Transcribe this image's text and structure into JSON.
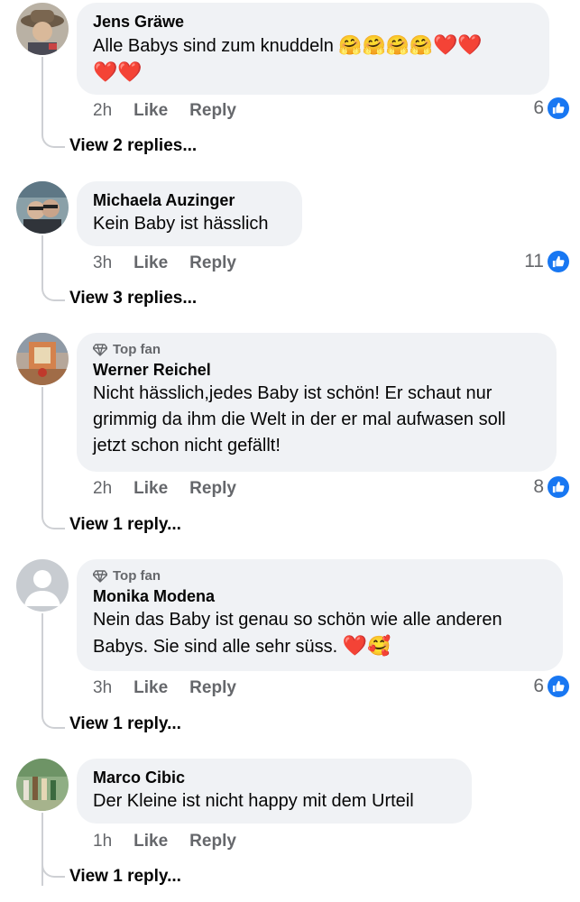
{
  "comments": [
    {
      "name": "Jens Gräwe",
      "top_fan": false,
      "text": "Alle Babys sind zum knuddeln",
      "emoji": [
        "🤗",
        "🤗",
        "🤗",
        "🤗",
        "❤️",
        "❤️",
        "❤️",
        "❤️"
      ],
      "time": "2h",
      "like_label": "Like",
      "reply_label": "Reply",
      "reaction_count": "6",
      "view_replies": "View 2 replies..."
    },
    {
      "name": "Michaela Auzinger",
      "top_fan": false,
      "text": "Kein Baby ist hässlich",
      "time": "3h",
      "like_label": "Like",
      "reply_label": "Reply",
      "reaction_count": "11",
      "view_replies": "View 3 replies..."
    },
    {
      "name": "Werner Reichel",
      "top_fan": true,
      "top_fan_label": "Top fan",
      "text": "Nicht hässlich,jedes Baby ist schön! Er schaut nur grimmig da ihm die Welt in der er mal aufwasen soll jetzt schon nicht gefällt!",
      "time": "2h",
      "like_label": "Like",
      "reply_label": "Reply",
      "reaction_count": "8",
      "view_replies": "View 1 reply..."
    },
    {
      "name": "Monika Modena",
      "top_fan": true,
      "top_fan_label": "Top fan",
      "text": "Nein das Baby ist genau so schön wie alle anderen Babys. Sie sind alle sehr süss.",
      "emoji": [
        "❤️",
        "🥰"
      ],
      "time": "3h",
      "like_label": "Like",
      "reply_label": "Reply",
      "reaction_count": "6",
      "view_replies": "View 1 reply..."
    },
    {
      "name": "Marco Cibic",
      "top_fan": false,
      "text": "Der Kleine ist nicht happy mit dem Urteil",
      "time": "1h",
      "like_label": "Like",
      "reply_label": "Reply",
      "view_replies": "View 1 reply..."
    }
  ],
  "colors": {
    "bubble": "#f0f2f5",
    "meta_text": "#65676b",
    "like_blue": "#1877f2",
    "thread_line": "#ced0d4"
  }
}
